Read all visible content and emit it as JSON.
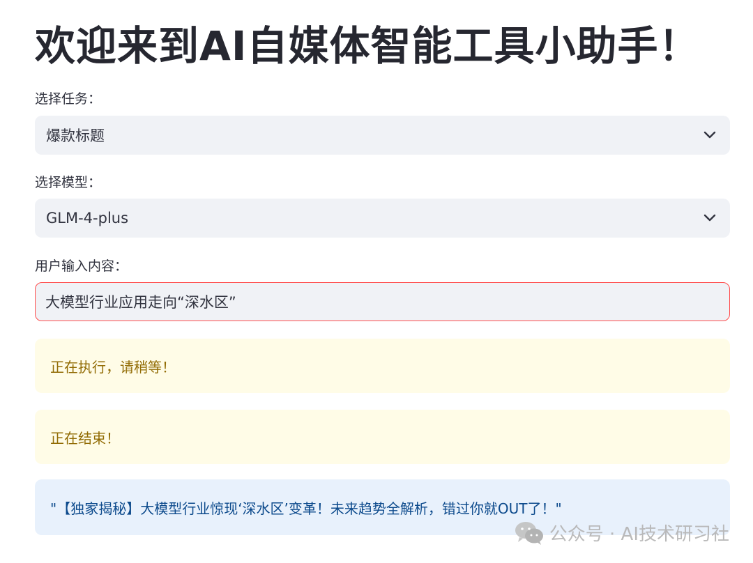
{
  "app": {
    "title": "欢迎来到AI自媒体智能工具小助手！"
  },
  "task": {
    "label": "选择任务：",
    "selected": "爆款标题"
  },
  "model": {
    "label": "选择模型：",
    "selected": "GLM-4-plus"
  },
  "input": {
    "label": "用户输入内容：",
    "value": "大模型行业应用走向“深水区”"
  },
  "status": {
    "running": "正在执行，请稍等！",
    "finished": "正在结束！"
  },
  "result": {
    "text": "\"【独家揭秘】大模型行业惊现‘深水区’变革！未来趋势全解析，错过你就OUT了！\""
  },
  "watermark": {
    "text": "公众号 · AI技术研习社",
    "icon": "wechat-icon"
  },
  "icons": {
    "select_chevron": "chevron-down-icon"
  },
  "colors": {
    "accent_border": "#ff4b4b",
    "field_bg": "#f0f2f6",
    "warning_bg": "#fffce7",
    "warning_text": "#926c05",
    "info_bg": "#e8f1fc",
    "info_text": "#0c4a8c"
  }
}
